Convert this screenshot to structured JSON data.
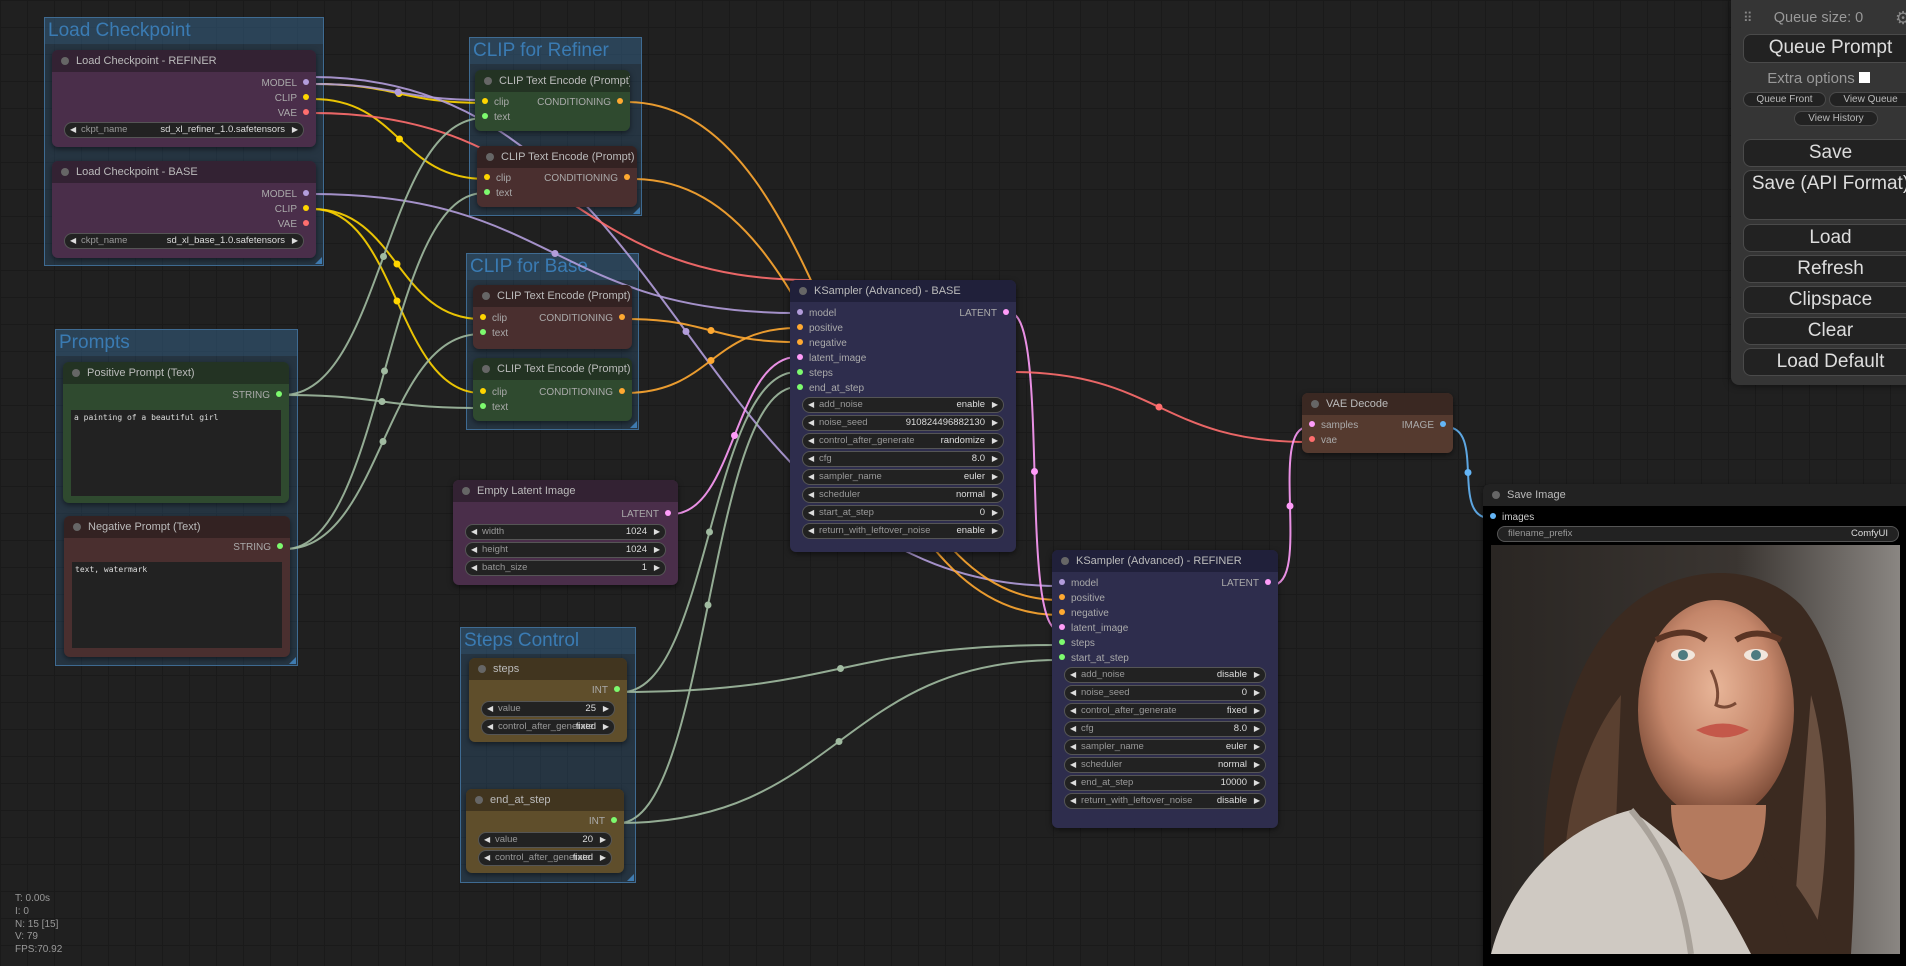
{
  "groups": {
    "load_checkpoint": "Load Checkpoint",
    "clip_refiner": "CLIP for Refiner",
    "clip_base": "CLIP for Base",
    "prompts": "Prompts",
    "steps_control": "Steps Control"
  },
  "nodes": {
    "ckpt_refiner": {
      "title": "Load Checkpoint - REFINER",
      "outputs": [
        "MODEL",
        "CLIP",
        "VAE"
      ],
      "widget": {
        "label": "ckpt_name",
        "value": "sd_xl_refiner_1.0.safetensors"
      }
    },
    "ckpt_base": {
      "title": "Load Checkpoint - BASE",
      "outputs": [
        "MODEL",
        "CLIP",
        "VAE"
      ],
      "widget": {
        "label": "ckpt_name",
        "value": "sd_xl_base_1.0.safetensors"
      }
    },
    "clip_ref_pos": {
      "title": "CLIP Text Encode (Prompt)",
      "inputs": [
        "clip",
        "text"
      ],
      "output": "CONDITIONING"
    },
    "clip_ref_neg": {
      "title": "CLIP Text Encode (Prompt)",
      "inputs": [
        "clip",
        "text"
      ],
      "output": "CONDITIONING"
    },
    "clip_base_neg": {
      "title": "CLIP Text Encode (Prompt)",
      "inputs": [
        "clip",
        "text"
      ],
      "output": "CONDITIONING"
    },
    "clip_base_pos": {
      "title": "CLIP Text Encode (Prompt)",
      "inputs": [
        "clip",
        "text"
      ],
      "output": "CONDITIONING"
    },
    "positive_prompt": {
      "title": "Positive Prompt (Text)",
      "output": "STRING",
      "text": "a painting of a beautiful girl"
    },
    "negative_prompt": {
      "title": "Negative Prompt (Text)",
      "output": "STRING",
      "text": "text, watermark"
    },
    "empty_latent": {
      "title": "Empty Latent Image",
      "output": "LATENT",
      "widgets": [
        {
          "label": "width",
          "value": "1024"
        },
        {
          "label": "height",
          "value": "1024"
        },
        {
          "label": "batch_size",
          "value": "1"
        }
      ]
    },
    "steps": {
      "title": "steps",
      "output": "INT",
      "widgets": [
        {
          "label": "value",
          "value": "25"
        },
        {
          "label": "control_after_generate",
          "value": "fixed"
        }
      ]
    },
    "end_at_step": {
      "title": "end_at_step",
      "output": "INT",
      "widgets": [
        {
          "label": "value",
          "value": "20"
        },
        {
          "label": "control_after_generate",
          "value": "fixed"
        }
      ]
    },
    "ksampler_base": {
      "title": "KSampler (Advanced) - BASE",
      "inputs": [
        "model",
        "positive",
        "negative",
        "latent_image",
        "steps",
        "end_at_step"
      ],
      "output": "LATENT",
      "widgets": [
        {
          "label": "add_noise",
          "value": "enable"
        },
        {
          "label": "noise_seed",
          "value": "910824496882130"
        },
        {
          "label": "control_after_generate",
          "value": "randomize"
        },
        {
          "label": "cfg",
          "value": "8.0"
        },
        {
          "label": "sampler_name",
          "value": "euler"
        },
        {
          "label": "scheduler",
          "value": "normal"
        },
        {
          "label": "start_at_step",
          "value": "0"
        },
        {
          "label": "return_with_leftover_noise",
          "value": "enable"
        }
      ]
    },
    "ksampler_refiner": {
      "title": "KSampler (Advanced) - REFINER",
      "inputs": [
        "model",
        "positive",
        "negative",
        "latent_image",
        "steps",
        "start_at_step"
      ],
      "output": "LATENT",
      "widgets": [
        {
          "label": "add_noise",
          "value": "disable"
        },
        {
          "label": "noise_seed",
          "value": "0"
        },
        {
          "label": "control_after_generate",
          "value": "fixed"
        },
        {
          "label": "cfg",
          "value": "8.0"
        },
        {
          "label": "sampler_name",
          "value": "euler"
        },
        {
          "label": "scheduler",
          "value": "normal"
        },
        {
          "label": "end_at_step",
          "value": "10000"
        },
        {
          "label": "return_with_leftover_noise",
          "value": "disable"
        }
      ]
    },
    "vae_decode": {
      "title": "VAE Decode",
      "inputs": [
        "samples",
        "vae"
      ],
      "output": "IMAGE"
    },
    "save_image": {
      "title": "Save Image",
      "input": "images",
      "widget": {
        "label": "filename_prefix",
        "value": "ComfyUI"
      },
      "preview": "generated portrait painting of a woman with long brown hair and white blouse"
    }
  },
  "panel": {
    "queue_size": "Queue size: 0",
    "queue_prompt": "Queue Prompt",
    "extra_options": "Extra options",
    "extra_options_checked": false,
    "queue_front": "Queue Front",
    "view_queue": "View Queue",
    "view_history": "View History",
    "save": "Save",
    "save_api": "Save (API Format)",
    "load": "Load",
    "refresh": "Refresh",
    "clipspace": "Clipspace",
    "clear": "Clear",
    "load_default": "Load Default"
  },
  "stats": {
    "t": "T: 0.00s",
    "i": "I: 0",
    "n": "N: 15 [15]",
    "v": "V: 79",
    "fps": "FPS:70.92"
  },
  "colors": {
    "MODEL": "#b39ddb",
    "CLIP": "#ffd500",
    "VAE": "#ff6e6e",
    "CONDITIONING": "#ffa931",
    "LATENT": "#ff9cf9",
    "IMAGE": "#64b5f6",
    "STRING": "#a1bba1",
    "INT": "#a1bba1",
    "green_dot": "#7dfa6e"
  }
}
